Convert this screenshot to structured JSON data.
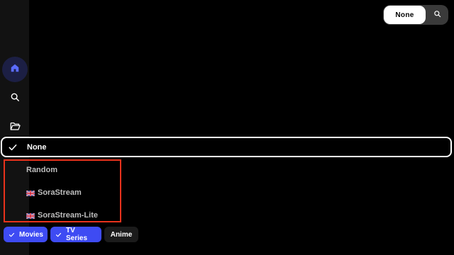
{
  "sidebar": {
    "items": [
      {
        "icon": "home-icon",
        "active": true
      },
      {
        "icon": "search-icon",
        "active": false
      },
      {
        "icon": "folder-icon",
        "active": false
      }
    ]
  },
  "source_switch": {
    "current": "None",
    "search_icon": "search-icon"
  },
  "source_menu": {
    "selected": "None",
    "options": [
      {
        "label": "Random"
      },
      {
        "label": "SoraStream",
        "flag": "gb-flag-icon"
      },
      {
        "label": "SoraStream-Lite",
        "flag": "gb-flag-icon"
      }
    ]
  },
  "filters": [
    {
      "label": "Movies",
      "active": true
    },
    {
      "label": "TV Series",
      "active": true
    },
    {
      "label": "Anime",
      "active": false
    }
  ],
  "colors": {
    "accent": "#3e4bf3",
    "highlight_border": "#e8321c",
    "sidebar_bg": "#121212"
  }
}
